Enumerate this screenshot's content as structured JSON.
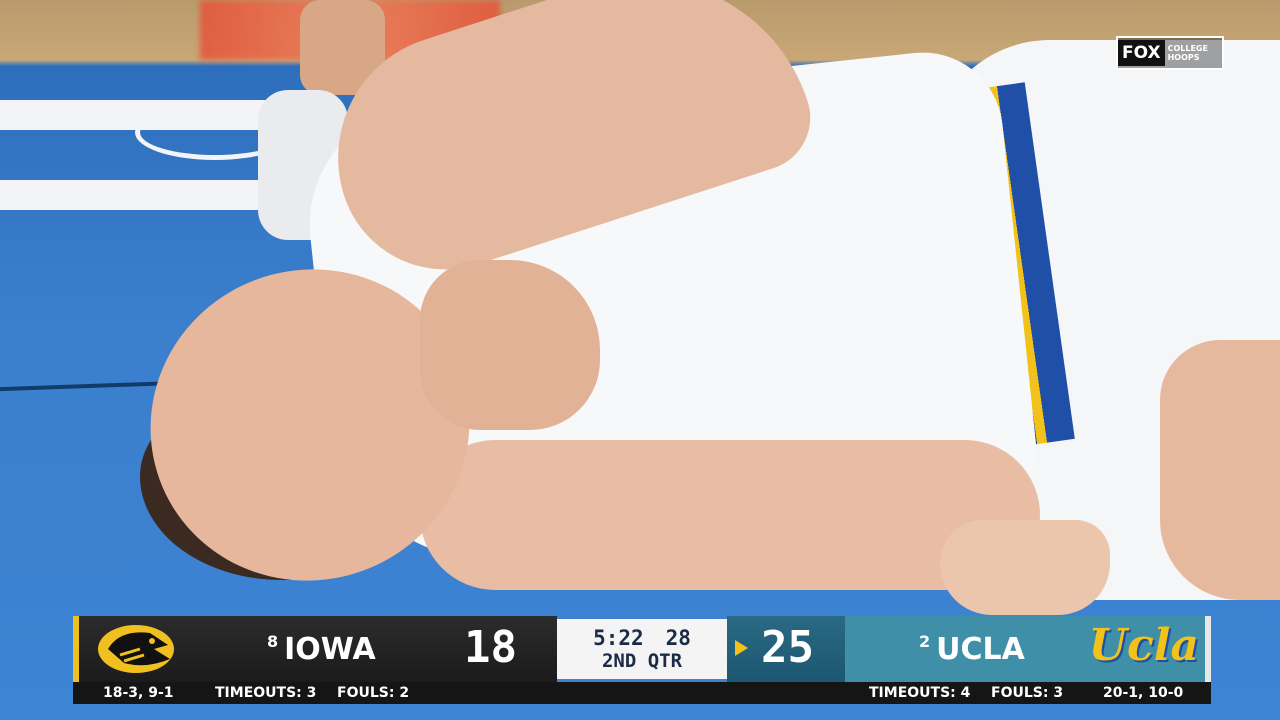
{
  "network_bug": {
    "brand": "FOX",
    "sub": "COLLEGE\nHOOPS"
  },
  "scorebug": {
    "away": {
      "rank": "8",
      "name": "IOWA",
      "score": "18",
      "record": "18-3, 9-1",
      "timeouts_label": "TIMEOUTS:",
      "timeouts": "3",
      "fouls_label": "FOULS:",
      "fouls": "2",
      "logo_icon": "iowa-hawkeye-logo",
      "accent": "#f0c020"
    },
    "home": {
      "rank": "2",
      "name": "UCLA",
      "score": "25",
      "record": "20-1, 10-0",
      "timeouts_label": "TIMEOUTS:",
      "timeouts": "4",
      "fouls_label": "FOULS:",
      "fouls": "3",
      "logo_text": "Ucla",
      "has_possession": true,
      "accent": "#f2c21b"
    },
    "clock": {
      "time": "5:22",
      "shot_clock": "28",
      "period": "2ND QTR"
    }
  }
}
